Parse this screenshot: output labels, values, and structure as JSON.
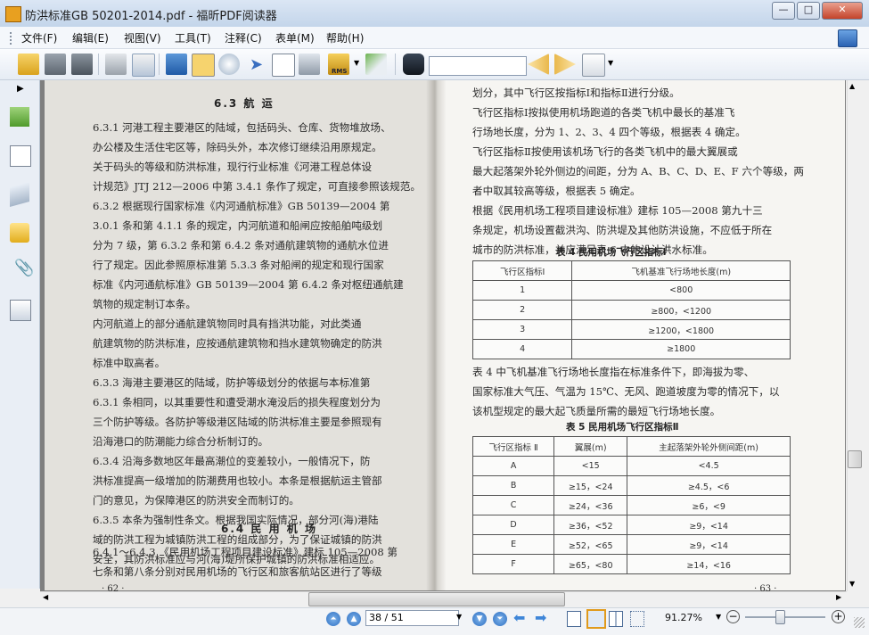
{
  "window": {
    "title": "防洪标准GB 50201-2014.pdf - 福昕PDF阅读器",
    "minimize": "—",
    "maximize": "□",
    "close": "✕"
  },
  "menu": [
    "文件(F)",
    "编辑(E)",
    "视图(V)",
    "工具(T)",
    "注释(C)",
    "表单(M)",
    "帮助(H)"
  ],
  "toolbar": {
    "icons": [
      "open-icon",
      "save-icon",
      "save-as-icon",
      "print-icon",
      "email-icon",
      "fullscreen-icon",
      "hand-tool-icon",
      "snapshot-zoom-icon",
      "select-icon",
      "text-select-icon",
      "camera-icon",
      "rms-lock-icon",
      "sign-icon",
      "find-icon",
      "prev-find-icon",
      "next-find-icon",
      "options-icon"
    ],
    "find_placeholder": "",
    "rms_label": "RMS"
  },
  "sidebar": {
    "icons": [
      "bookmarks-icon",
      "pages-icon",
      "layers-icon",
      "comments-icon",
      "attachments-icon",
      "signatures-icon"
    ]
  },
  "left_page": {
    "section_title": "6.3 航 运",
    "lines": [
      "6.3.1  河港工程主要港区的陆域，包括码头、仓库、货物堆放场、",
      "办公楼及生活住宅区等，除码头外，本次修订继续沿用原规定。",
      "    关于码头的等级和防洪标准，现行行业标准《河港工程总体设",
      "计规范》JTJ 212—2006 中第 3.4.1 条作了规定，可直接参照该规范。",
      "6.3.2  根据现行国家标准《内河通航标准》GB 50139—2004 第",
      "3.0.1 条和第 4.1.1 条的规定，内河航道和船闸应按船舶吨级划",
      "分为 7 级，第 6.3.2 条和第 6.4.2 条对通航建筑物的通航水位进",
      "行了规定。因此参照原标准第 5.3.3 条对船闸的规定和现行国家",
      "标准《内河通航标准》GB 50139—2004 第 6.4.2 条对枢纽通航建",
      "筑物的规定制订本条。",
      "    内河航道上的部分通航建筑物同时具有挡洪功能，对此类通",
      "航建筑物的防洪标准，应按通航建筑物和挡水建筑物确定的防洪",
      "标准中取高者。",
      "6.3.3  海港主要港区的陆域，防护等级划分的依据与本标准第",
      "6.3.1 条相同，以其重要性和遭受潮水淹没后的损失程度划分为",
      "三个防护等级。各防护等级港区陆域的防洪标准主要是参照现有",
      "沿海港口的防潮能力综合分析制订的。",
      "6.3.4  沿海多数地区年最高潮位的变差较小，一般情况下，防",
      "洪标准提高一级增加的防潮费用也较小。本条是根据航运主管部",
      "门的意见，为保障港区的防洪安全而制订的。",
      "6.3.5  本条为强制性条文。根据我国实际情况，部分河(海)港陆",
      "域的防洪工程为城镇防洪工程的组成部分，为了保证城镇的防洪",
      "安全，其防洪标准应与河(海)堤所保护城镇的防洪标准相适应。"
    ],
    "section2_title": "6.4 民 用 机 场",
    "lines2": [
      "6.4.1～6.4.3 《民用机场工程项目建设标准》建标 105—2008 第",
      "七条和第八条分别对民用机场的飞行区和旅客航站区进行了等级"
    ],
    "page_number": "· 62 ·"
  },
  "right_page": {
    "lines": [
      "划分，其中飞行区按指标Ⅰ和指标Ⅱ进行分级。",
      "    飞行区指标Ⅰ按拟使用机场跑道的各类飞机中最长的基准飞",
      "行场地长度，分为 1、2、3、4 四个等级，根据表 4 确定。",
      "    飞行区指标Ⅱ按使用该机场飞行的各类飞机中的最大翼展或",
      "最大起落架外轮外侧边的间距，分为 A、B、C、D、E、F 六个等级，两",
      "者中取其较高等级，根据表 5 确定。",
      "    根据《民用机场工程项目建设标准》建标 105—2008 第九十三",
      "条规定，机场设置截洪沟、防洪堤及其他防洪设施，不应低于所在",
      "城市的防洪标准，并应满足表 6 中的设计洪水标准。"
    ],
    "table4": {
      "caption": "表 4   民用机场飞行区指标Ⅰ",
      "headers": [
        "飞行区指标Ⅰ",
        "飞机基准飞行场地长度(m)"
      ],
      "rows": [
        [
          "1",
          "<800"
        ],
        [
          "2",
          "≥800，<1200"
        ],
        [
          "3",
          "≥1200，<1800"
        ],
        [
          "4",
          "≥1800"
        ]
      ]
    },
    "lines_mid": [
      "    表 4 中飞机基准飞行场地长度指在标准条件下，即海拔为零、",
      "国家标准大气压、气温为 15℃、无风、跑道坡度为零的情况下，以",
      "该机型规定的最大起飞质量所需的最短飞行场地长度。"
    ],
    "table5": {
      "caption": "表 5   民用机场飞行区指标Ⅱ",
      "headers": [
        "飞行区指标 Ⅱ",
        "翼展(m)",
        "主起落架外轮外侧间距(m)"
      ],
      "rows": [
        [
          "A",
          "<15",
          "<4.5"
        ],
        [
          "B",
          "≥15，<24",
          "≥4.5，<6"
        ],
        [
          "C",
          "≥24，<36",
          "≥6，<9"
        ],
        [
          "D",
          "≥36，<52",
          "≥9，<14"
        ],
        [
          "E",
          "≥52，<65",
          "≥9，<14"
        ],
        [
          "F",
          "≥65，<80",
          "≥14，<16"
        ]
      ]
    },
    "page_number": "· 63 ·"
  },
  "status": {
    "page_field": "38 / 51",
    "zoom": "91.27%",
    "zoom_out": "−",
    "zoom_in": "+"
  }
}
